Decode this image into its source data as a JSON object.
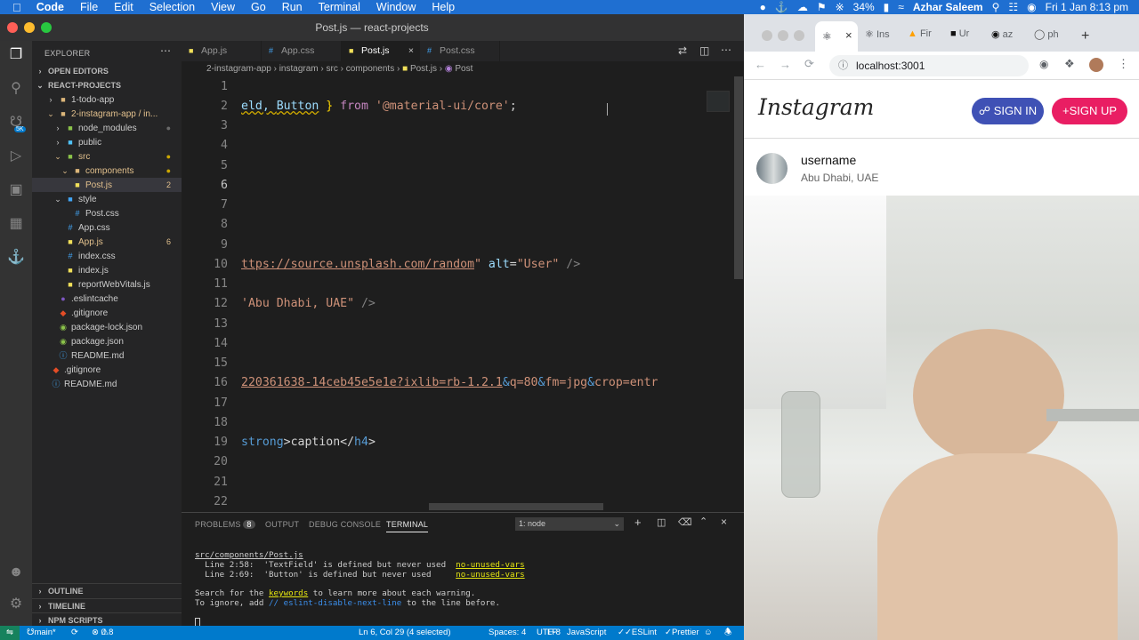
{
  "menubar": {
    "app": "Code",
    "items": [
      "File",
      "Edit",
      "Selection",
      "View",
      "Go",
      "Run",
      "Terminal",
      "Window",
      "Help"
    ],
    "battery": "34%",
    "user": "Azhar Saleem",
    "datetime": "Fri 1 Jan  8:13 pm"
  },
  "vscode": {
    "window_title": "Post.js — react-projects",
    "explorer_label": "EXPLORER",
    "open_editors": "OPEN EDITORS",
    "project": "REACT-PROJECTS",
    "tree": [
      {
        "label": "1-todo-app",
        "type": "folder",
        "badge": ""
      },
      {
        "label": "2-instagram-app / in...",
        "type": "folder",
        "badge": ""
      },
      {
        "label": "node_modules",
        "type": "folder",
        "badge": ""
      },
      {
        "label": "public",
        "type": "folder",
        "badge": ""
      },
      {
        "label": "src",
        "type": "folder",
        "badge": ""
      },
      {
        "label": "components",
        "type": "folder",
        "badge": ""
      },
      {
        "label": "Post.js",
        "type": "js",
        "badge": "2"
      },
      {
        "label": "style",
        "type": "folder",
        "badge": ""
      },
      {
        "label": "Post.css",
        "type": "css",
        "badge": ""
      },
      {
        "label": "App.css",
        "type": "css",
        "badge": ""
      },
      {
        "label": "App.js",
        "type": "js",
        "badge": "6"
      },
      {
        "label": "index.css",
        "type": "css",
        "badge": ""
      },
      {
        "label": "index.js",
        "type": "js",
        "badge": ""
      },
      {
        "label": "reportWebVitals.js",
        "type": "js",
        "badge": ""
      },
      {
        "label": ".eslintcache",
        "type": "file",
        "badge": ""
      },
      {
        "label": ".gitignore",
        "type": "git",
        "badge": ""
      },
      {
        "label": "package-lock.json",
        "type": "json",
        "badge": ""
      },
      {
        "label": "package.json",
        "type": "json",
        "badge": ""
      },
      {
        "label": "README.md",
        "type": "info",
        "badge": ""
      },
      {
        "label": ".gitignore",
        "type": "git",
        "badge": ""
      },
      {
        "label": "README.md",
        "type": "info",
        "badge": ""
      }
    ],
    "outline": "OUTLINE",
    "timeline": "TIMELINE",
    "npm_scripts": "NPM SCRIPTS",
    "tabs": [
      "App.js",
      "App.css",
      "Post.js",
      "Post.css"
    ],
    "breadcrumb": [
      "2-instagram-app",
      "instagram",
      "src",
      "components",
      "Post.js",
      "Post"
    ],
    "line_numbers": [
      "1",
      "2",
      "3",
      "4",
      "5",
      "6",
      "7",
      "8",
      "9",
      "10",
      "11",
      "12",
      "13",
      "14",
      "15",
      "16",
      "17",
      "18",
      "19",
      "20",
      "21",
      "22"
    ],
    "code": {
      "l2a": "eld, ",
      "l2b": "Button",
      "l2c": " } ",
      "l2d": "from",
      "l2e": " ",
      "l2f": "'@material-ui/core'",
      "l2g": ";",
      "l10a": "ttps://source.unsplash.com/random",
      "l10b": "\" ",
      "l10c": "alt",
      "l10d": "=",
      "l10e": "\"User\"",
      "l10f": " />",
      "l12a": "'Abu Dhabi, UAE\"",
      "l12b": " />",
      "l16a": "220361638-14ceb45e5e1e?ixlib=rb-1.2.1",
      "l16b": "&",
      "l16c": "q=80",
      "l16d": "&",
      "l16e": "fm=jpg",
      "l16f": "&",
      "l16g": "crop=entr",
      "l19a": "strong",
      "l19b": ">caption</",
      "l19c": "h4",
      "l19d": ">"
    },
    "panel": {
      "problems": "PROBLEMS",
      "problems_count": "8",
      "output": "OUTPUT",
      "debug": "DEBUG CONSOLE",
      "terminal": "TERMINAL",
      "select": "1: node"
    },
    "terminal": {
      "file": "src/components/Post.js",
      "w1a": "  Line 2:58:  'TextField' is defined but never used  ",
      "w1b": "no-unused-vars",
      "w2a": "  Line 2:69:  'Button' is defined but never used     ",
      "w2b": "no-unused-vars",
      "s1a": "Search for the ",
      "s1b": "keywords",
      "s1c": " to learn more about each warning.",
      "s2a": "To ignore, add ",
      "s2b": "// eslint-disable-next-line",
      "s2c": " to the line before."
    },
    "status": {
      "branch": "main*",
      "errors": "0",
      "warnings": "8",
      "position": "Ln 6, Col 29 (4 selected)",
      "spaces": "Spaces: 4",
      "encoding": "UTF-8",
      "eol": "LF",
      "language": "JavaScript",
      "eslint": "ESLint",
      "prettier": "Prettier"
    }
  },
  "chrome": {
    "tabs": [
      "Ins",
      "Fir",
      "Ur",
      "az",
      "ph"
    ],
    "url": "localhost:3001",
    "ig": {
      "logo": "Instagram",
      "sign_in": "SIGN IN",
      "sign_up": "SIGN UP",
      "username": "username",
      "location": "Abu Dhabi, UAE"
    }
  }
}
